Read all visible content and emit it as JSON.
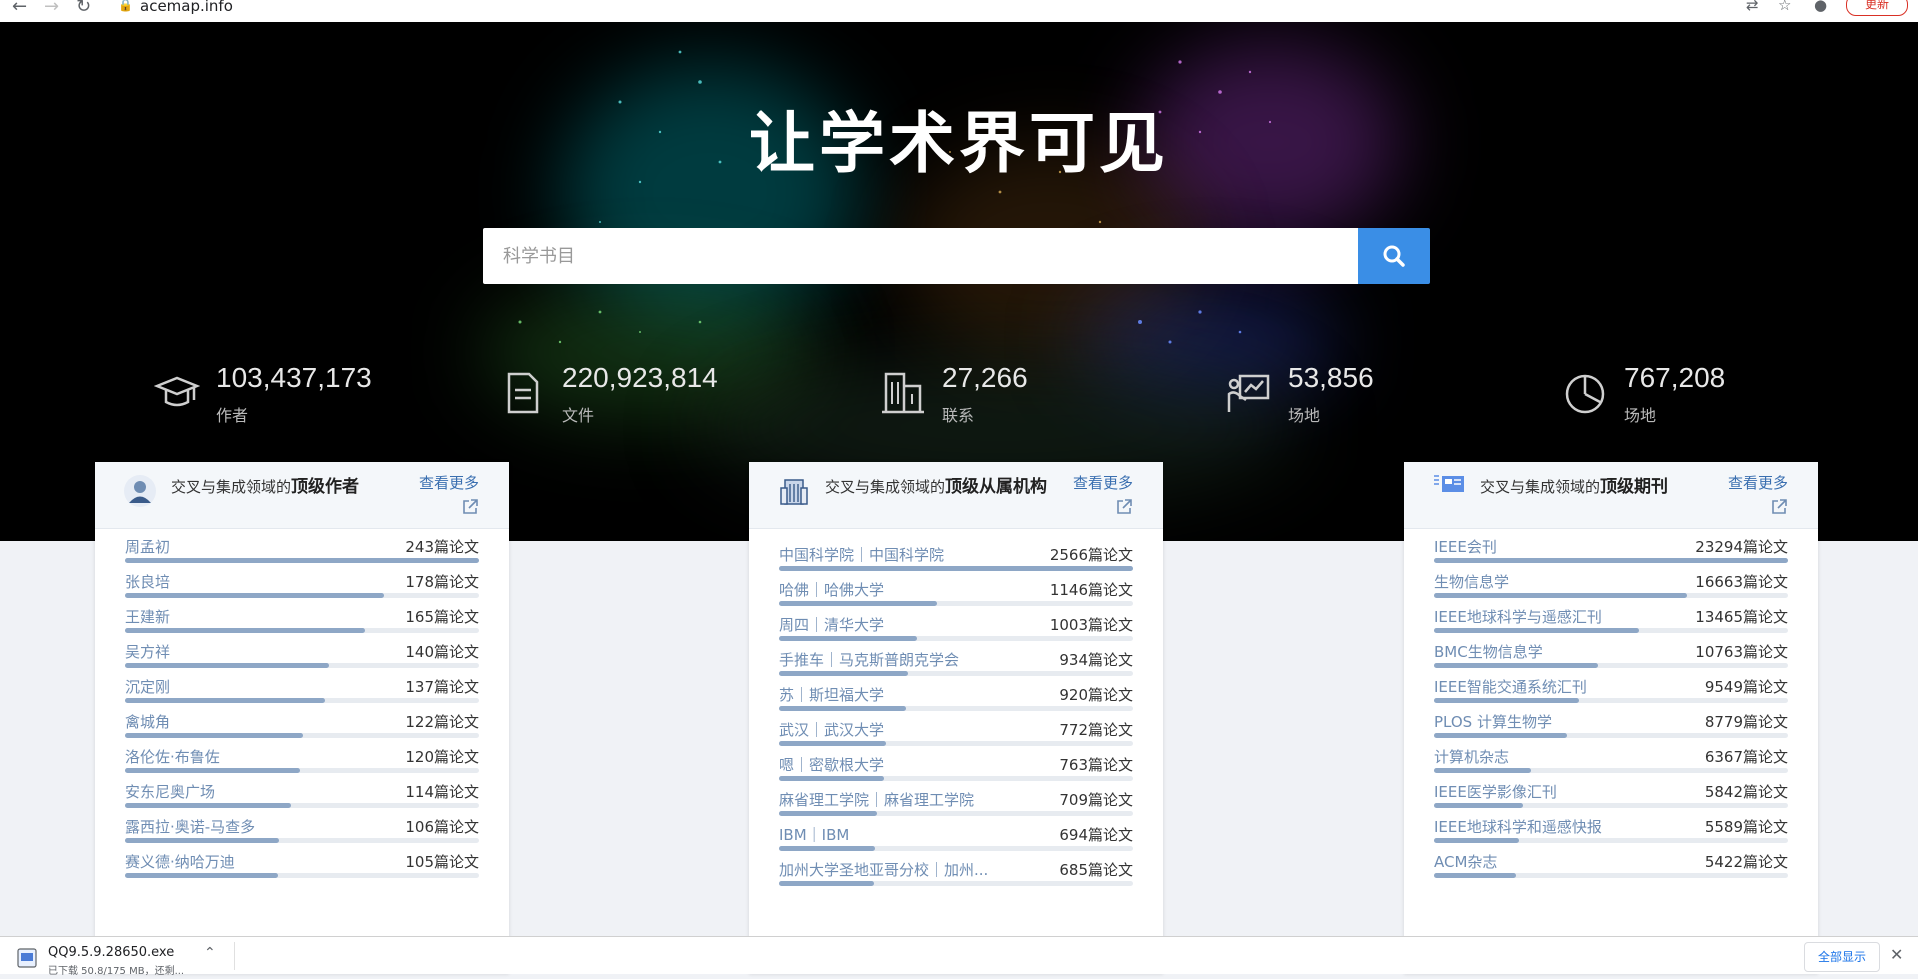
{
  "browser": {
    "url": "acemap.info",
    "update_label": "更新"
  },
  "hero": {
    "title": "让学术界可见",
    "search_placeholder": "科学书目"
  },
  "stats": [
    {
      "value": "103,437,173",
      "label": "作者",
      "icon": "graduation-cap-icon"
    },
    {
      "value": "220,923,814",
      "label": "文件",
      "icon": "document-icon"
    },
    {
      "value": "27,266",
      "label": "联系",
      "icon": "building-icon"
    },
    {
      "value": "53,856",
      "label": "场地",
      "icon": "presentation-chart-icon"
    },
    {
      "value": "767,208",
      "label": "场地",
      "icon": "pie-chart-icon"
    }
  ],
  "cards": {
    "authors": {
      "prefix": "交叉与集成领域的",
      "title": "顶级作者",
      "more": "查看更多",
      "rows": [
        {
          "name": "周孟初",
          "count": "243篇论文",
          "fill": 1.0
        },
        {
          "name": "张良培",
          "count": "178篇论文",
          "fill": 0.733
        },
        {
          "name": "王建新",
          "count": "165篇论文",
          "fill": 0.679
        },
        {
          "name": "吴方祥",
          "count": "140篇论文",
          "fill": 0.576
        },
        {
          "name": "沉定刚",
          "count": "137篇论文",
          "fill": 0.564
        },
        {
          "name": "禽城角",
          "count": "122篇论文",
          "fill": 0.502
        },
        {
          "name": "洛伦佐·布鲁佐",
          "count": "120篇论文",
          "fill": 0.494
        },
        {
          "name": "安东尼奥广场",
          "count": "114篇论文",
          "fill": 0.469
        },
        {
          "name": "露西拉·奥诺-马查多",
          "count": "106篇论文",
          "fill": 0.436
        },
        {
          "name": "赛义德·纳哈万迪",
          "count": "105篇论文",
          "fill": 0.432
        }
      ]
    },
    "institutions": {
      "prefix": "交叉与集成领域的",
      "title": "顶级从属机构",
      "more": "查看更多",
      "rows": [
        {
          "name": "中国科学院｜中国科学院",
          "count": "2566篇论文",
          "fill": 1.0
        },
        {
          "name": "哈佛｜哈佛大学",
          "count": "1146篇论文",
          "fill": 0.447
        },
        {
          "name": "周四｜清华大学",
          "count": "1003篇论文",
          "fill": 0.391
        },
        {
          "name": "手推车｜马克斯普朗克学会",
          "count": "934篇论文",
          "fill": 0.364
        },
        {
          "name": "苏｜斯坦福大学",
          "count": "920篇论文",
          "fill": 0.359
        },
        {
          "name": "武汉｜武汉大学",
          "count": "772篇论文",
          "fill": 0.301
        },
        {
          "name": "嗯｜密歇根大学",
          "count": "763篇论文",
          "fill": 0.297
        },
        {
          "name": "麻省理工学院｜麻省理工学院",
          "count": "709篇论文",
          "fill": 0.276
        },
        {
          "name": "IBM｜IBM",
          "count": "694篇论文",
          "fill": 0.27
        },
        {
          "name": "加州大学圣地亚哥分校｜加州...",
          "count": "685篇论文",
          "fill": 0.267
        }
      ]
    },
    "journals": {
      "prefix": "交叉与集成领域的",
      "title": "顶级期刊",
      "more": "查看更多",
      "rows": [
        {
          "name": "IEEE会刊",
          "count": "23294篇论文",
          "fill": 1.0
        },
        {
          "name": "生物信息学",
          "count": "16663篇论文",
          "fill": 0.715
        },
        {
          "name": "IEEE地球科学与遥感汇刊",
          "count": "13465篇论文",
          "fill": 0.578
        },
        {
          "name": "BMC生物信息学",
          "count": "10763篇论文",
          "fill": 0.462
        },
        {
          "name": "IEEE智能交通系统汇刊",
          "count": "9549篇论文",
          "fill": 0.41
        },
        {
          "name": "PLOS 计算生物学",
          "count": "8779篇论文",
          "fill": 0.377
        },
        {
          "name": "计算机杂志",
          "count": "6367篇论文",
          "fill": 0.273
        },
        {
          "name": "IEEE医学影像汇刊",
          "count": "5842篇论文",
          "fill": 0.251
        },
        {
          "name": "IEEE地球科学和遥感快报",
          "count": "5589篇论文",
          "fill": 0.24
        },
        {
          "name": "ACM杂志",
          "count": "5422篇论文",
          "fill": 0.233
        }
      ]
    },
    "pager": {
      "prev": "‹",
      "next": "›"
    }
  },
  "download": {
    "filename": "QQ9.5.9.28650.exe",
    "progress": "已下载 50.8/175 MB，还剩...",
    "show_all": "全部显示",
    "close": "✕"
  }
}
